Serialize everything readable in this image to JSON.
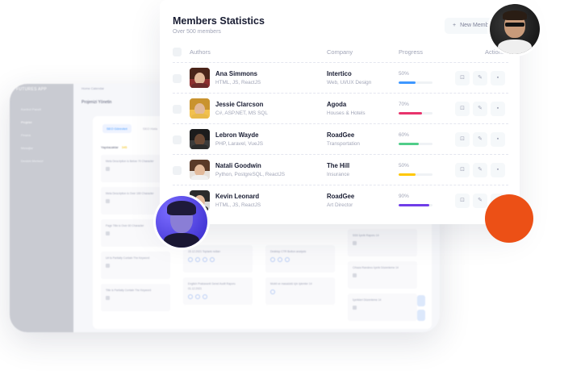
{
  "background_app": {
    "brand": "FUTURES APP",
    "menu": [
      "Kontrol Paneli",
      "Projeler",
      "Finans",
      "Mesajlar",
      "Destek Merkezi"
    ],
    "breadcrumb": "Home   Calendar",
    "project_title": "Projenizi Yönetin",
    "tabs": [
      "SEO Görevleri",
      "SEO Hata"
    ],
    "column_title": "Yapılacaklar",
    "column_count": "345",
    "col1_items": [
      "Meta Description is Below 70 Character",
      "Meta Description is Over 160 Character",
      "Page Title is Over 60 Character",
      "Url is Partially Contain The Keyword",
      "Title is Partially Contain The Keyword"
    ],
    "col2_items": [
      "15.12.2021 Toplantı notları",
      "English Prabaxanti Genel Audit Raporu 01.12.2021"
    ],
    "col3_items": [
      "Desktop CTR Button analysis",
      "Mobil ve masaüstü için işlemler 14"
    ],
    "col4_items": [
      "SSS İçerik Raporu 14",
      "Cihaza Randevu İçerik Düzenleme 14",
      "İçerikleri Düzenleme 14"
    ]
  },
  "card": {
    "title": "Members Statistics",
    "subtitle": "Over 500 members",
    "new_button": "New Member",
    "columns": {
      "authors": "Authors",
      "company": "Company",
      "progress": "Progress",
      "actions": "Actions"
    },
    "rows": [
      {
        "name": "Ana Simmons",
        "skills": "HTML, JS, ReactJS",
        "company": "Intertico",
        "dept": "Web, UI/UX Design",
        "progress": 50,
        "progress_label": "50%",
        "bar_color": "#3e97ff",
        "avatar_bg": "#8c2f2f"
      },
      {
        "name": "Jessie Clarcson",
        "skills": "C#, ASP.NET, MS SQL",
        "company": "Agoda",
        "dept": "Houses & Hotels",
        "progress": 70,
        "progress_label": "70%",
        "bar_color": "#e8336c",
        "avatar_bg": "#f2c14e"
      },
      {
        "name": "Lebron Wayde",
        "skills": "PHP, Laravel, VueJS",
        "company": "RoadGee",
        "dept": "Transportation",
        "progress": 60,
        "progress_label": "60%",
        "bar_color": "#50cd89",
        "avatar_bg": "#3b3b3b"
      },
      {
        "name": "Natali Goodwin",
        "skills": "Python, PostgreSQL, ReactJS",
        "company": "The Hill",
        "dept": "Insurance",
        "progress": 50,
        "progress_label": "50%",
        "bar_color": "#ffc700",
        "avatar_bg": "#e6e1dc"
      },
      {
        "name": "Kevin Leonard",
        "skills": "HTML, JS, ReactJS",
        "company": "RoadGee",
        "dept": "Art Director",
        "progress": 90,
        "progress_label": "90%",
        "bar_color": "#6f3de8",
        "avatar_bg": "#d9d9d9"
      }
    ],
    "action_icons": [
      "toggle-icon",
      "edit-icon",
      "delete-icon"
    ]
  },
  "colors": {
    "orange": "#ec5016",
    "primary": "#3e97ff"
  }
}
